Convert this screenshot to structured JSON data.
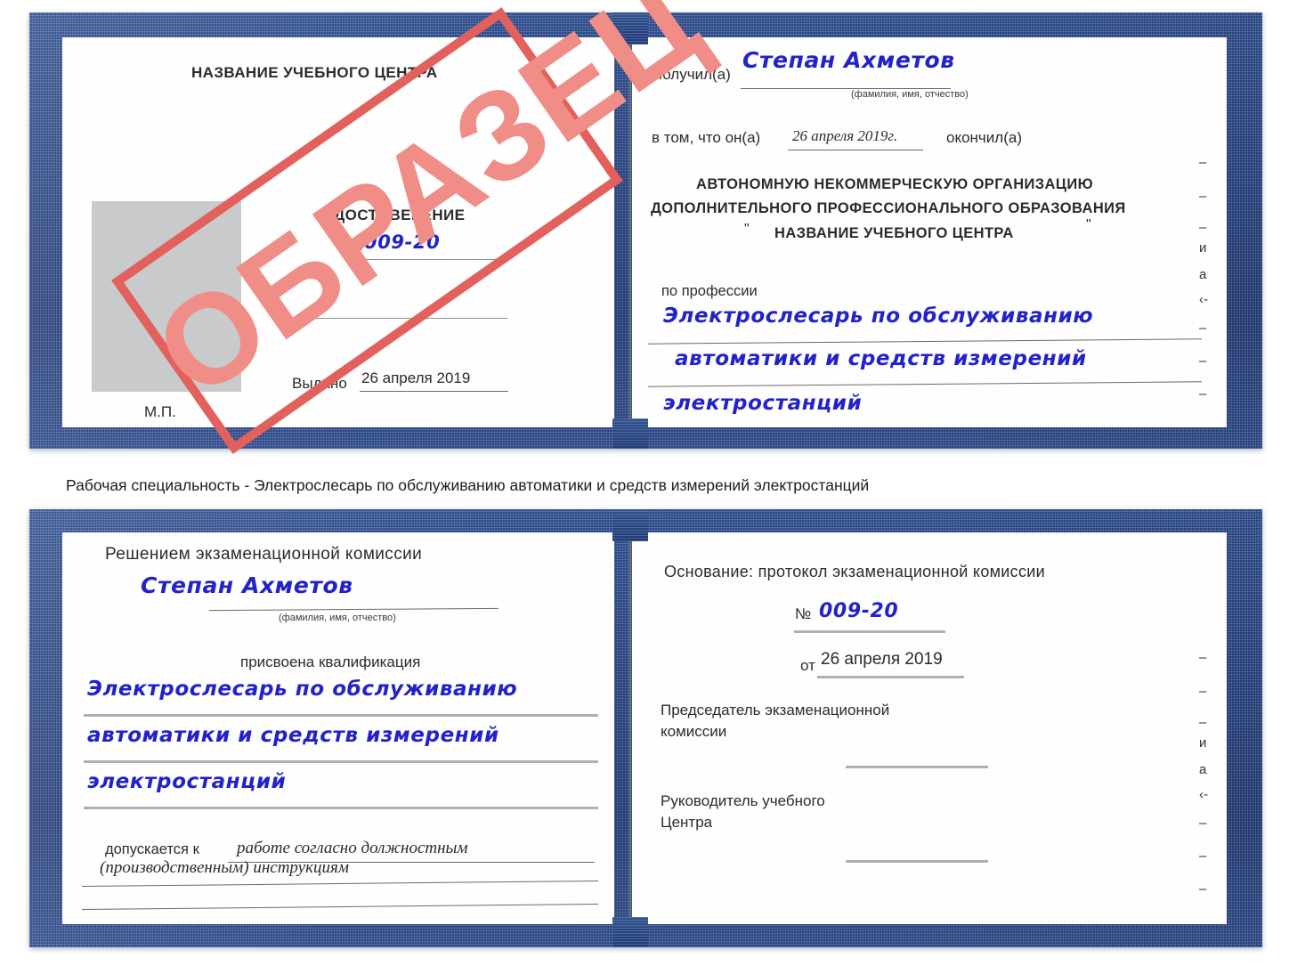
{
  "document": {
    "type": "certificate-scan",
    "colors": {
      "cover_blue": "#26427e",
      "ink_blue": "#2222cc",
      "stamp_red": "#e2615c",
      "stamp_red_fill": "#f08d87",
      "paper": "#fefefe",
      "photo_placeholder": "#c9cacb",
      "rule_gray": "#8d8d8d"
    }
  },
  "stamp": {
    "label": "ОБРАЗЕЦ"
  },
  "certificate_top": {
    "left_page": {
      "center_name": "НАЗВАНИЕ УЧЕБНОГО ЦЕНТРА",
      "title": "УДОСТОВЕРЕНИЕ",
      "number_label": "№",
      "number_value": "009-20",
      "issued_label": "Выдано",
      "issued_value": "26 апреля 2019",
      "stamp_place": "М.П."
    },
    "right_page": {
      "received_label": "Получил(а)",
      "received_value": "Степан Ахметов",
      "fio_hint": "(фамилия, имя, отчество)",
      "that_he_label": "в том, что он(а)",
      "completion_date": "26 апреля 2019г.",
      "finished_label": "окончил(а)",
      "org_line1": "АВТОНОМНУЮ НЕКОММЕРЧЕСКУЮ ОРГАНИЗАЦИЮ",
      "org_line2": "ДОПОЛНИТЕЛЬНОГО ПРОФЕССИОНАЛЬНОГО ОБРАЗОВАНИЯ",
      "org_quote_open": "\"",
      "org_name": "НАЗВАНИЕ УЧЕБНОГО ЦЕНТРА",
      "org_quote_close": "\"",
      "profession_label": "по профессии",
      "profession_line1": "Электрослесарь по обслуживанию",
      "profession_line2": "автоматики и средств измерений",
      "profession_line3": "электростанций",
      "edge_fragments": [
        "–",
        "–",
        "–",
        "и",
        "а",
        "‹-",
        "–",
        "–",
        "–"
      ]
    }
  },
  "caption": {
    "text": "Рабочая специальность - Электрослесарь по обслуживанию автоматики и средств измерений электростанций"
  },
  "certificate_bottom": {
    "left_page": {
      "heading": "Решением экзаменационной комиссии",
      "name_value": "Степан Ахметов",
      "fio_hint": "(фамилия, имя, отчество)",
      "qualification_label": "присвоена квалификация",
      "qualification_line1": "Электрослесарь по обслуживанию",
      "qualification_line2": "автоматики и средств измерений",
      "qualification_line3": "электростанций",
      "admitted_label": "допускается к",
      "admitted_value_line1": "работе согласно должностным",
      "admitted_value_line2": "(производственным) инструкциям"
    },
    "right_page": {
      "basis_label": "Основание: протокол экзаменационной комиссии",
      "number_label": "№",
      "number_value": "009-20",
      "date_label": "от",
      "date_value": "26 апреля 2019",
      "chairman_line1": "Председатель экзаменационной",
      "chairman_line2": "комиссии",
      "head_line1": "Руководитель учебного",
      "head_line2": "Центра",
      "edge_fragments": [
        "–",
        "–",
        "–",
        "и",
        "а",
        "‹-",
        "–",
        "–",
        "–"
      ]
    }
  }
}
